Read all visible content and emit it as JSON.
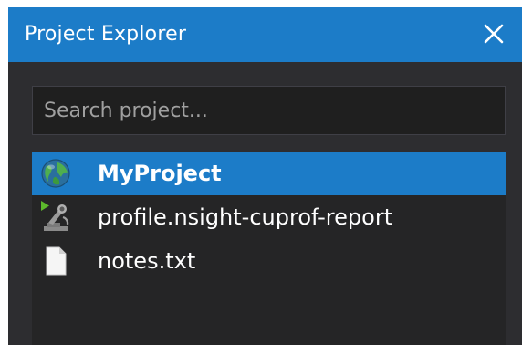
{
  "panel": {
    "title": "Project Explorer",
    "close_icon": "close-icon"
  },
  "search": {
    "placeholder": "Search project...",
    "value": ""
  },
  "tree": {
    "items": [
      {
        "label": "MyProject",
        "icon": "project-globe-icon",
        "selected": true
      },
      {
        "label": "profile.nsight-cuprof-report",
        "icon": "profiler-report-icon",
        "selected": false
      },
      {
        "label": "notes.txt",
        "icon": "text-file-icon",
        "selected": false
      }
    ]
  },
  "colors": {
    "title_bar": "#1c7cc8",
    "panel_bg": "#2d2d30",
    "selection": "#1c7cc8",
    "text": "#ffffff"
  }
}
